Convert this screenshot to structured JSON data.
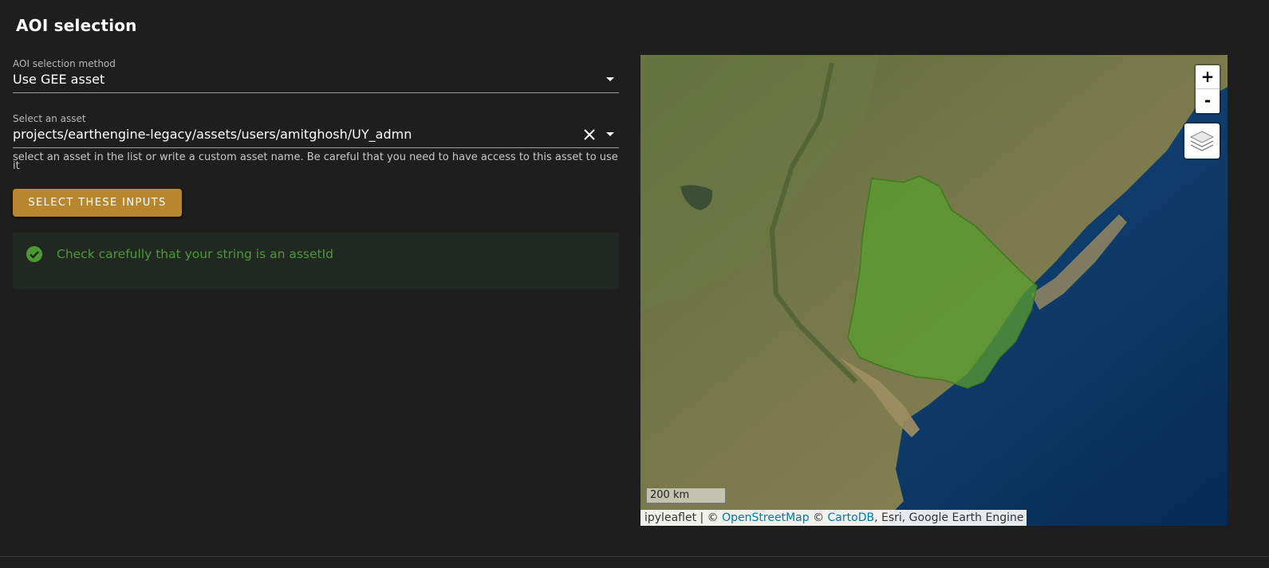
{
  "page": {
    "title": "AOI selection"
  },
  "method_select": {
    "label": "AOI selection method",
    "value": "Use GEE asset"
  },
  "asset_select": {
    "label": "Select an asset",
    "value": "projects/earthengine-legacy/assets/users/amitghosh/UY_admn",
    "hint": "select an asset in the list or write a custom asset name. Be careful that you need to have access to this asset to use it"
  },
  "select_button": {
    "label": "SELECT THESE INPUTS"
  },
  "alert": {
    "message": "Check carefully that your string is an assetId",
    "icon": "check-circle-icon"
  },
  "map": {
    "zoom_in": "+",
    "zoom_out": "-",
    "layers_icon": "layers-icon",
    "scale": "200 km",
    "attribution": {
      "prefix": "ipyleaflet | © ",
      "osm_link": "OpenStreetMap",
      "mid": " © ",
      "carto_link": "CartoDB",
      "suffix": ", Esri, Google Earth Engine"
    }
  },
  "colors": {
    "background": "#1e1e1e",
    "button": "#b8862c",
    "success": "#4c9a35",
    "alert_bg": "#212721",
    "aoi_fill": "#5a9e2e",
    "ocean": "#0b3366",
    "link": "#0078a8"
  }
}
